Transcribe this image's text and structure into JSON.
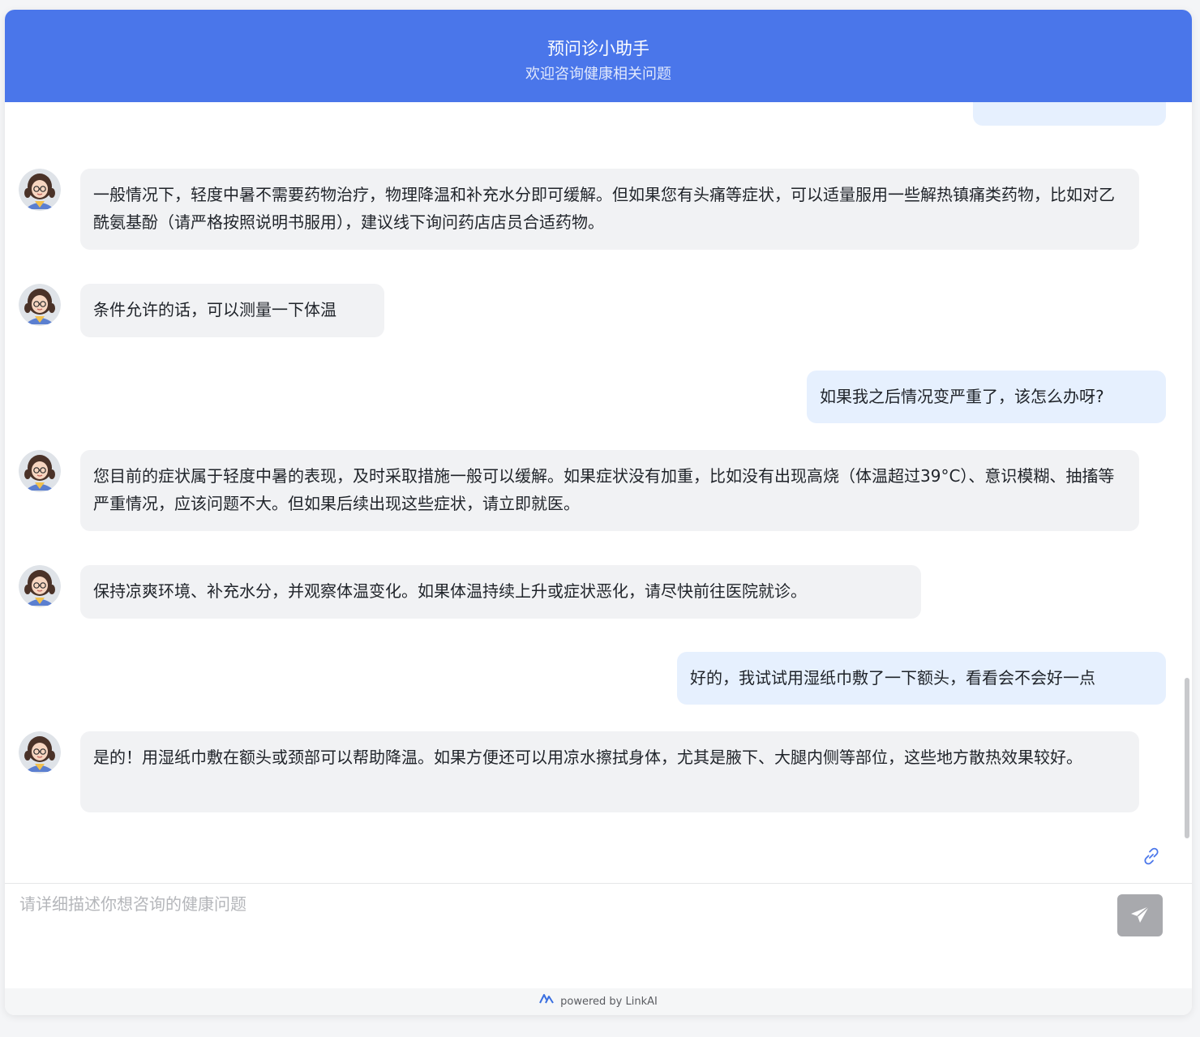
{
  "header": {
    "title": "预问诊小助手",
    "subtitle": "欢迎咨询健康相关问题"
  },
  "messages": [
    {
      "role": "bot",
      "text": "一般情况下，轻度中暑不需要药物治疗，物理降温和补充水分即可缓解。但如果您有头痛等症状，可以适量服用一些解热镇痛类药物，比如对乙酰氨基酚（请严格按照说明书服用），建议线下询问药店店员合适药物。"
    },
    {
      "role": "bot",
      "text": "条件允许的话，可以测量一下体温"
    },
    {
      "role": "user",
      "text": "如果我之后情况变严重了，该怎么办呀?"
    },
    {
      "role": "bot",
      "text": "您目前的症状属于轻度中暑的表现，及时采取措施一般可以缓解。如果症状没有加重，比如没有出现高烧（体温超过39°C）、意识模糊、抽搐等严重情况，应该问题不大。但如果后续出现这些症状，请立即就医。"
    },
    {
      "role": "bot",
      "text": "保持凉爽环境、补充水分，并观察体温变化。如果体温持续上升或症状恶化，请尽快前往医院就诊。"
    },
    {
      "role": "user",
      "text": "好的，我试试用湿纸巾敷了一下额头，看看会不会好一点"
    },
    {
      "role": "bot",
      "text": "是的！用湿纸巾敷在额头或颈部可以帮助降温。如果方便还可以用凉水擦拭身体，尤其是腋下、大腿内侧等部位，这些地方散热效果较好。"
    }
  ],
  "input": {
    "placeholder": "请详细描述你想咨询的健康问题",
    "value": ""
  },
  "footer": {
    "text": "powered by LinkAI"
  },
  "colors": {
    "header_bg": "#4a76ea",
    "bot_bubble": "#f1f2f4",
    "user_bubble": "#e6f0fe",
    "send_button": "#a8a9ad"
  },
  "icons": {
    "avatar": "assistant-avatar-icon",
    "link": "link-icon",
    "send": "send-icon",
    "logo": "linkai-logo-icon"
  }
}
